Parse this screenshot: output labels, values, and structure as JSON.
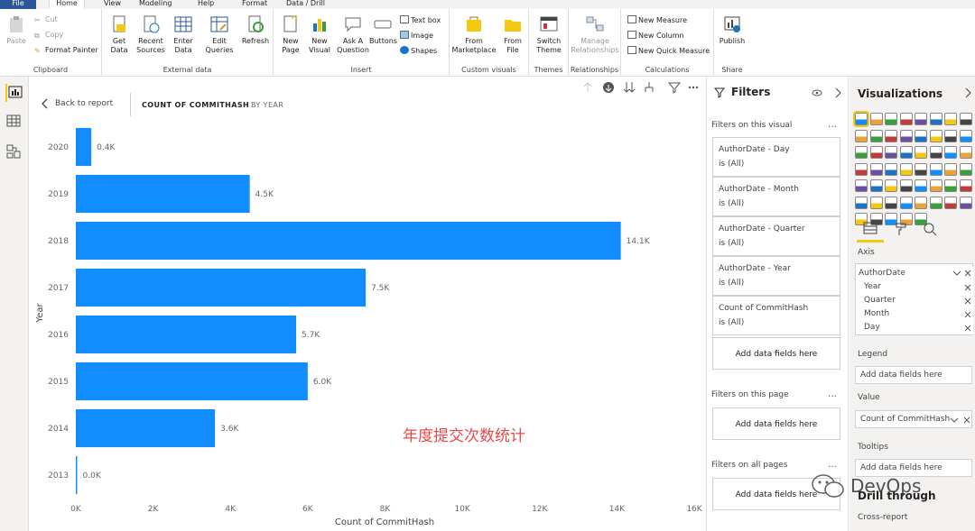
{
  "menu": {
    "file": "File",
    "home": "Home",
    "view": "View",
    "modeling": "Modeling",
    "help": "Help",
    "format": "Format",
    "data_drill": "Data / Drill"
  },
  "ribbon": {
    "clipboard": {
      "label": "Clipboard",
      "paste": "Paste",
      "cut": "Cut",
      "copy": "Copy",
      "format_painter": "Format Painter"
    },
    "external_data": {
      "label": "External data",
      "get_data": "Get Data",
      "recent_sources": "Recent Sources",
      "enter_data": "Enter Data",
      "edit_queries": "Edit Queries",
      "refresh": "Refresh"
    },
    "insert": {
      "label": "Insert",
      "new_page": "New Page",
      "new_visual": "New Visual",
      "ask_question": "Ask A Question",
      "buttons": "Buttons",
      "text_box": "Text box",
      "image": "Image",
      "shapes": "Shapes"
    },
    "custom_visuals": {
      "label": "Custom visuals",
      "from_marketplace": "From Marketplace",
      "from_file": "From File"
    },
    "themes": {
      "label": "Themes",
      "switch_theme": "Switch Theme"
    },
    "relationships": {
      "label": "Relationships",
      "manage": "Manage Relationships"
    },
    "calculations": {
      "label": "Calculations",
      "new_measure": "New Measure",
      "new_column": "New Column",
      "new_quick_measure": "New Quick Measure"
    },
    "share": {
      "label": "Share",
      "publish": "Publish"
    }
  },
  "canvas": {
    "back_label": "Back to report",
    "title_main": "COUNT OF COMMITHASH",
    "title_sub": "BY YEAR",
    "annotation": "年度提交次数统计",
    "watermark": "DevOps"
  },
  "chart_data": {
    "type": "bar",
    "orientation": "horizontal",
    "categories": [
      "2020",
      "2019",
      "2018",
      "2017",
      "2016",
      "2015",
      "2014",
      "2013"
    ],
    "values": [
      0.4,
      4.5,
      14.1,
      7.5,
      5.7,
      6.0,
      3.6,
      0.0
    ],
    "data_labels": [
      "0.4K",
      "4.5K",
      "14.1K",
      "7.5K",
      "5.7K",
      "6.0K",
      "3.6K",
      "0.0K"
    ],
    "xticks": [
      "0K",
      "2K",
      "4K",
      "6K",
      "8K",
      "10K",
      "12K",
      "14K",
      "16K"
    ],
    "xlim": [
      0,
      16
    ],
    "xlabel": "Count of CommitHash",
    "ylabel": "Year",
    "bar_color": "#118dff"
  },
  "filters": {
    "title": "Filters",
    "on_visual": "Filters on this visual",
    "cards": [
      {
        "name": "AuthorDate - Day",
        "state": "is (All)"
      },
      {
        "name": "AuthorDate - Month",
        "state": "is (All)"
      },
      {
        "name": "AuthorDate - Quarter",
        "state": "is (All)"
      },
      {
        "name": "AuthorDate - Year",
        "state": "is (All)"
      },
      {
        "name": "Count of CommitHash",
        "state": "is (All)"
      }
    ],
    "add_fields": "Add data fields here",
    "on_page": "Filters on this page",
    "on_all": "Filters on all pages"
  },
  "visualizations": {
    "title": "Visualizations",
    "axis_label": "Axis",
    "axis_fields": [
      "AuthorDate",
      "Year",
      "Quarter",
      "Month",
      "Day"
    ],
    "legend_label": "Legend",
    "value_label": "Value",
    "value_field": "Count of CommitHash",
    "tooltips_label": "Tooltips",
    "add_fields": "Add data fields here",
    "drill_through": "Drill through",
    "cross_report": "Cross-report"
  }
}
